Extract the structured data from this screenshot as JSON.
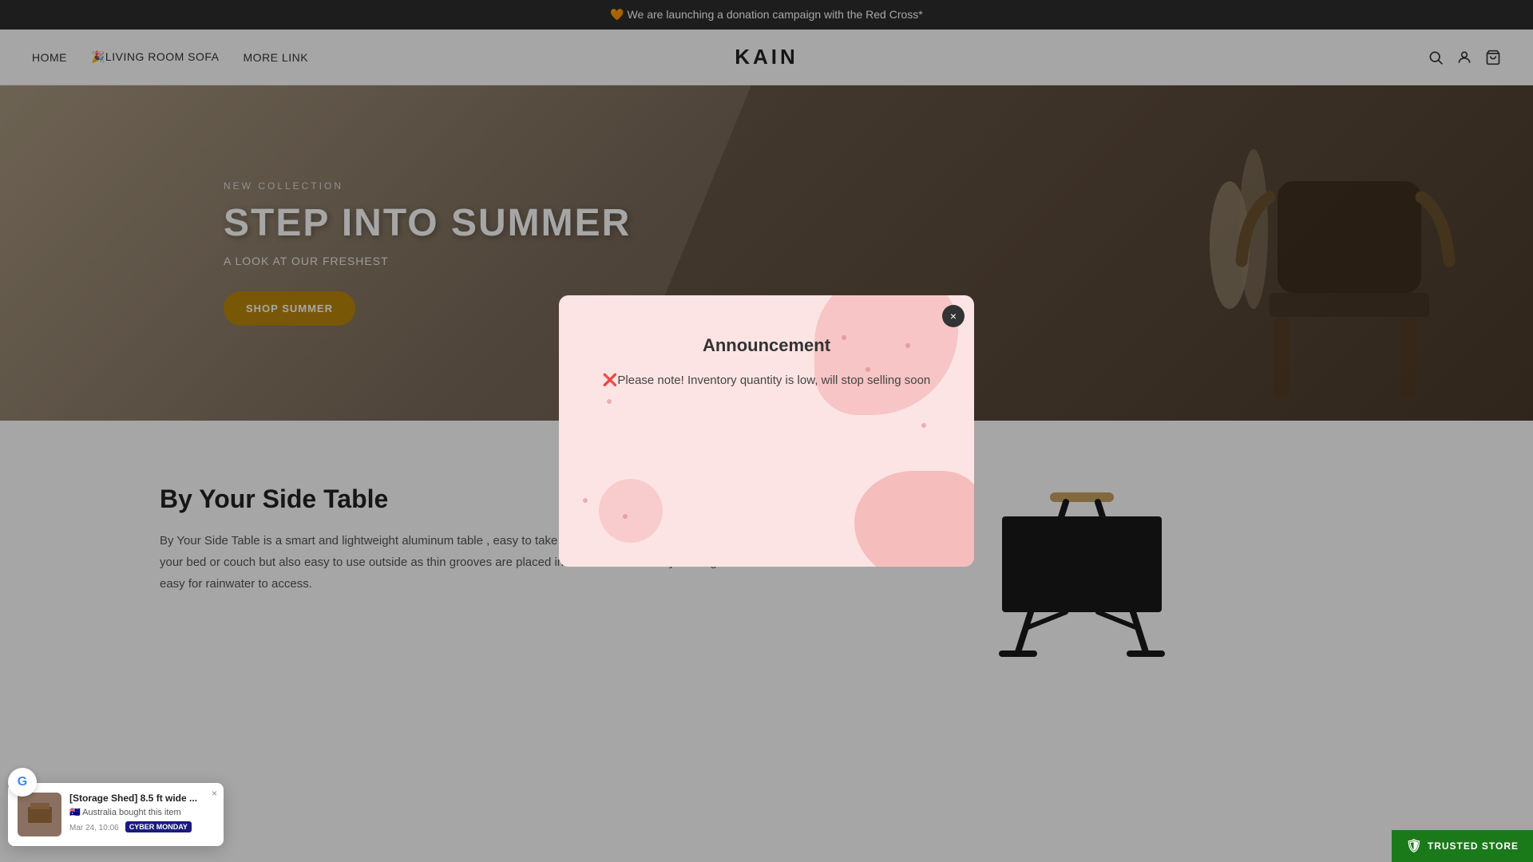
{
  "topbar": {
    "text": "🧡 We are launching a donation campaign with the Red Cross*"
  },
  "navbar": {
    "home": "HOME",
    "living_room": "🎉LIVING ROOM SOFA",
    "more_link": "MORE LINK",
    "brand": "KAIN"
  },
  "hero": {
    "subtitle": "NEW COLLECTION",
    "title": "STEP INTO SUMMER",
    "description": "A LOOK AT OUR FRESHEST",
    "cta": "SHOP SUMMER"
  },
  "modal": {
    "title": "Announcement",
    "body": "❌Please note! Inventory quantity is low, will stop selling soon",
    "close_label": "×"
  },
  "product": {
    "title": "By Your Side Table",
    "description": "By Your Side Table is a smart and lightweight aluminum table , easy to take with you. A good choice next to your bed or couch but also easy to use outside as thin grooves are placed in each side of the tray making it easy for rainwater to access."
  },
  "notification": {
    "title": "[Storage Shed] 8.5 ft wide ...",
    "flag": "🇦🇺 Australia bought this item",
    "time": "Mar 24, 10:06",
    "badge": "CYBER MONDAY",
    "close": "×"
  },
  "trusted": {
    "label": "TRUSTED STORE",
    "icon": "🛡"
  },
  "icons": {
    "search": "⌕",
    "user": "👤",
    "cart": "🛒"
  }
}
